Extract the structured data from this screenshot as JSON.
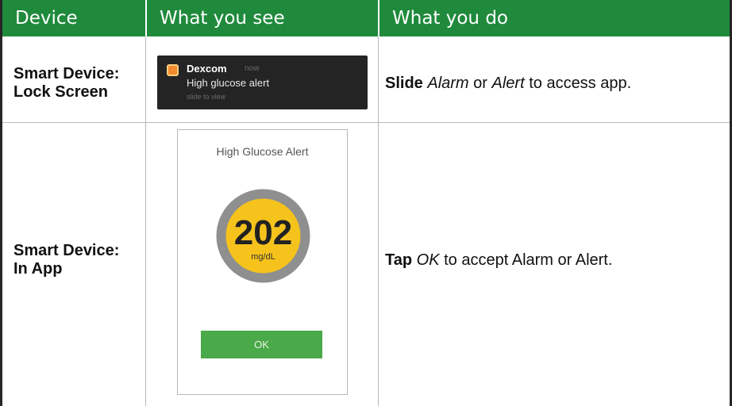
{
  "headers": {
    "device": "Device",
    "what_you_see": "What you see",
    "what_you_do": "What you do"
  },
  "rows": [
    {
      "device_line1": "Smart Device:",
      "device_line2": "Lock Screen",
      "notification": {
        "app_name": "Dexcom",
        "time": "now",
        "message": "High glucose alert",
        "slide_hint": "slide to view",
        "icon": "dexcom-app-icon"
      },
      "action": {
        "verb": "Slide",
        "obj1": "Alarm",
        "connector": "or",
        "obj2": "Alert",
        "rest": "to access app."
      }
    },
    {
      "device_line1": "Smart Device:",
      "device_line2": "In App",
      "screen": {
        "title": "High Glucose Alert",
        "glucose_value": "202",
        "glucose_unit": "mg/dL",
        "ok_label": "OK"
      },
      "action": {
        "verb": "Tap",
        "obj": "OK",
        "rest": "to accept Alarm or Alert."
      }
    }
  ],
  "colors": {
    "header_green": "#1f8a3c",
    "ok_green": "#4aa948",
    "gauge_yellow": "#f5c31b",
    "gauge_ring": "#8f8f8f",
    "lock_bg": "#242424"
  }
}
